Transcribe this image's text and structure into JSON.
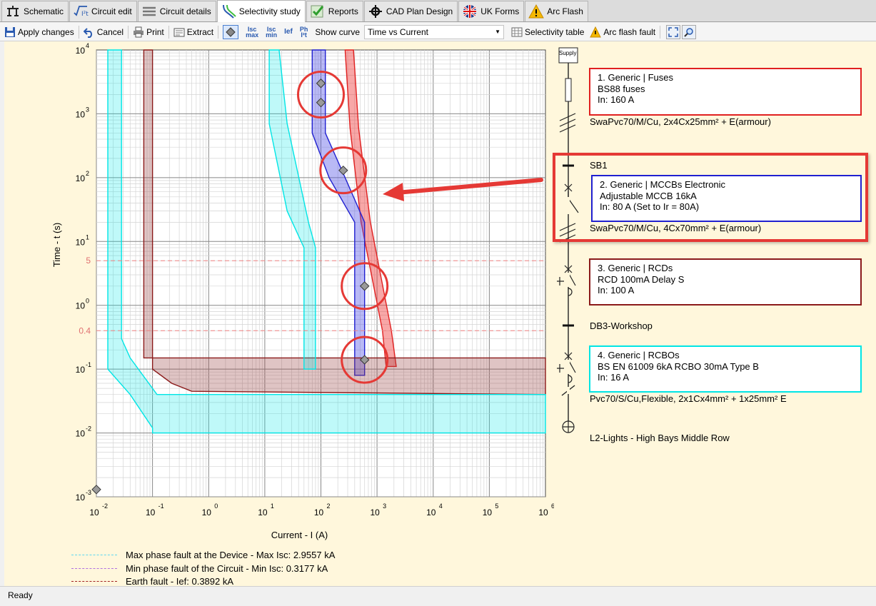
{
  "tabs": [
    {
      "label": "Schematic",
      "icon": "schematic-icon"
    },
    {
      "label": "Circuit edit",
      "icon": "formula-icon"
    },
    {
      "label": "Circuit details",
      "icon": "list-icon"
    },
    {
      "label": "Selectivity study",
      "icon": "curves-icon",
      "active": true
    },
    {
      "label": "Reports",
      "icon": "checkmark-icon"
    },
    {
      "label": "CAD Plan Design",
      "icon": "crosshair-icon"
    },
    {
      "label": "UK Forms",
      "icon": "uk-flag-icon"
    },
    {
      "label": "Arc Flash",
      "icon": "warning-icon"
    }
  ],
  "toolbar": {
    "apply": "Apply changes",
    "cancel": "Cancel",
    "print": "Print",
    "extract": "Extract",
    "isc_max_top": "Isc",
    "isc_max_bottom": "max",
    "isc_min_top": "Isc",
    "isc_min_bottom": "min",
    "ief": "Ief",
    "ph_top": "Ph",
    "ph_bottom": "I²t",
    "show_curve_label": "Show curve",
    "show_curve_value": "Time vs Current",
    "selectivity_table": "Selectivity table",
    "arc_flash_fault": "Arc flash fault"
  },
  "status": "Ready",
  "chart_data": {
    "type": "line",
    "title": "",
    "xlabel": "Current - I (A)",
    "ylabel": "Time - t (s)",
    "xscale": "log",
    "yscale": "log",
    "xlim": [
      0.01,
      1000000
    ],
    "ylim": [
      0.001,
      10000
    ],
    "x_ticks": [
      {
        "base": "10",
        "exp": "-2"
      },
      {
        "base": "10",
        "exp": "-1"
      },
      {
        "base": "10",
        "exp": "0"
      },
      {
        "base": "10",
        "exp": "1"
      },
      {
        "base": "10",
        "exp": "2"
      },
      {
        "base": "10",
        "exp": "3"
      },
      {
        "base": "10",
        "exp": "4"
      },
      {
        "base": "10",
        "exp": "5"
      },
      {
        "base": "10",
        "exp": "6"
      }
    ],
    "y_ticks": [
      {
        "base": "10",
        "exp": "4"
      },
      {
        "base": "10",
        "exp": "3"
      },
      {
        "base": "10",
        "exp": "2"
      },
      {
        "base": "10",
        "exp": "1"
      },
      {
        "base": "10",
        "exp": "0"
      },
      {
        "base": "10",
        "exp": "-1"
      },
      {
        "base": "10",
        "exp": "-2"
      },
      {
        "base": "10",
        "exp": "-3"
      }
    ],
    "reference_lines": [
      {
        "label": "5",
        "y": 5
      },
      {
        "label": "0.4",
        "y": 0.4
      }
    ],
    "grid": true,
    "colors": {
      "fuse": "#e02020",
      "mccb": "#2020d0",
      "rcd": "#8b1a1a",
      "rcbo": "#00e5e5",
      "highlight": "#e53935",
      "background": "#fff7dc"
    },
    "series": [
      {
        "device": 1,
        "color": "#e02020",
        "fill": "rgba(240,60,60,0.45)",
        "band": [
          {
            "left": [
              [
                270,
                10000
              ],
              [
                330,
                600
              ],
              [
                520,
                20
              ],
              [
                1250,
                0.4
              ],
              [
                1450,
                0.11
              ]
            ]
          },
          {
            "right": [
              [
                380,
                10000
              ],
              [
                470,
                600
              ],
              [
                760,
                20
              ],
              [
                1800,
                0.4
              ],
              [
                2200,
                0.11
              ]
            ]
          }
        ]
      },
      {
        "device": 2,
        "color": "#2020d0",
        "fill": "rgba(80,80,230,0.4)",
        "outline": [
          [
            70,
            10000
          ],
          [
            70,
            500
          ],
          [
            140,
            100
          ],
          [
            400,
            20
          ],
          [
            400,
            0.08
          ],
          [
            600,
            0.08
          ],
          [
            600,
            20
          ],
          [
            270,
            100
          ],
          [
            120,
            500
          ],
          [
            120,
            10000
          ]
        ]
      },
      {
        "device": 3,
        "color": "#8b1a1a",
        "fill": "rgba(150,60,60,0.3)",
        "outline": [
          [
            0.07,
            10000
          ],
          [
            0.07,
            0.15
          ],
          [
            0.7,
            0.15
          ],
          [
            1000000,
            0.15
          ],
          [
            1000000,
            0.04
          ],
          [
            0.5,
            0.045
          ],
          [
            0.22,
            0.06
          ],
          [
            0.1,
            0.1
          ],
          [
            0.1,
            10000
          ]
        ]
      },
      {
        "device": 4,
        "color": "#00e5e5",
        "fill": "rgba(0,230,230,0.25)",
        "outline": [
          [
            0.016,
            10000
          ],
          [
            0.016,
            0.1
          ],
          [
            0.04,
            0.04
          ],
          [
            0.1,
            0.012
          ],
          [
            0.1,
            0.01
          ],
          [
            1000000,
            0.01
          ],
          [
            1000000,
            0.04
          ],
          [
            0.12,
            0.04
          ],
          [
            0.04,
            0.15
          ],
          [
            0.028,
            0.3
          ],
          [
            0.028,
            10000
          ]
        ]
      },
      {
        "device": 4,
        "color": "#00e5e5",
        "fill": "rgba(0,230,230,0.25)",
        "outline": [
          [
            12,
            10000
          ],
          [
            12,
            700
          ],
          [
            25,
            30
          ],
          [
            50,
            8
          ],
          [
            50,
            0.1
          ],
          [
            80,
            0.1
          ],
          [
            80,
            8
          ],
          [
            60,
            20
          ],
          [
            25,
            700
          ],
          [
            18,
            10000
          ]
        ]
      }
    ],
    "markers": [
      {
        "x": 100,
        "y": 3000
      },
      {
        "x": 100,
        "y": 1500
      },
      {
        "x": 250,
        "y": 130
      },
      {
        "x": 600,
        "y": 2
      },
      {
        "x": 600,
        "y": 0.14
      },
      {
        "x": 0.01,
        "y": 0.0013
      }
    ],
    "highlight_circles": [
      {
        "x": 100,
        "y": 2000
      },
      {
        "x": 250,
        "y": 130
      },
      {
        "x": 600,
        "y": 2
      },
      {
        "x": 600,
        "y": 0.14
      }
    ]
  },
  "single_line": {
    "supply_label": "Supply",
    "devices": [
      {
        "title": "1. Generic | Fuses",
        "line2": "BS88 fuses",
        "line3": "In: 160 A",
        "border": "#e02020"
      },
      {
        "title": "2. Generic | MCCBs Electronic",
        "line2": "Adjustable MCCB 16kA",
        "line3": "In: 80 A (Set to Ir = 80A)",
        "border": "#2020d0"
      },
      {
        "title": "3. Generic | RCDs",
        "line2": "RCD 100mA Delay S",
        "line3": "In: 100 A",
        "border": "#8b1a1a"
      },
      {
        "title": "4. Generic | RCBOs",
        "line2": "BS EN 61009 6kA RCBO 30mA Type B",
        "line3": "In: 16 A",
        "border": "#00e5e5"
      }
    ],
    "cable1": "SwaPvc70/M/Cu, 2x4Cx25mm² + E(armour)",
    "board1": "SB1",
    "cable2": "SwaPvc70/M/Cu, 4Cx70mm² + E(armour)",
    "board2": "DB3-Workshop",
    "cable3": "Pvc70/S/Cu,Flexible, 2x1Cx4mm² + 1x25mm² E",
    "load": "L2-Lights - High Bays Middle Row"
  },
  "legend": [
    {
      "label": "Max phase fault at the Device - Max Isc: 2.9557 kA",
      "color": "#5fd6f0"
    },
    {
      "label": "Min phase fault of the Circuit - Min Isc: 0.3177 kA",
      "color": "#b070e0"
    },
    {
      "label": "Earth fault - Ief: 0.3892 kA",
      "color": "#a02020"
    }
  ]
}
